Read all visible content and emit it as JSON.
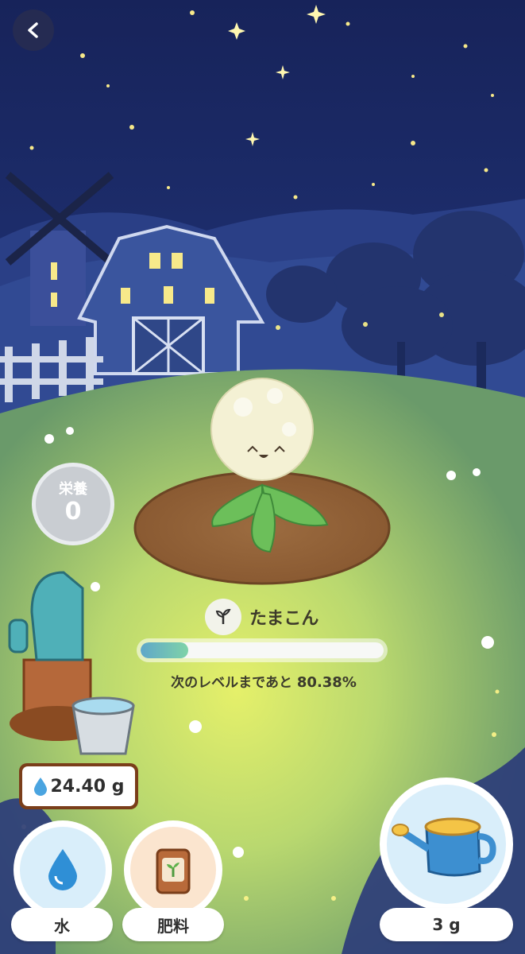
{
  "nav": {
    "back_icon": "chevron-left-icon"
  },
  "nutrition": {
    "label": "栄養",
    "value": "0"
  },
  "plant": {
    "name": "たまこん",
    "name_icon": "sprout-icon"
  },
  "progress": {
    "fraction": 0.1962,
    "text": "次のレベルまであと",
    "remaining": "80.38%",
    "fill_color": "#6cbcb4"
  },
  "water_stock": {
    "amount": "24.40 g",
    "icon": "water-drop-icon"
  },
  "actions": {
    "water_label": "水",
    "fertilizer_label": "肥料",
    "watering_can_amount": "3 g"
  },
  "colors": {
    "sky": "#1f2f6e",
    "grass": "#b9d67a",
    "accent": "#7a3e1a"
  }
}
